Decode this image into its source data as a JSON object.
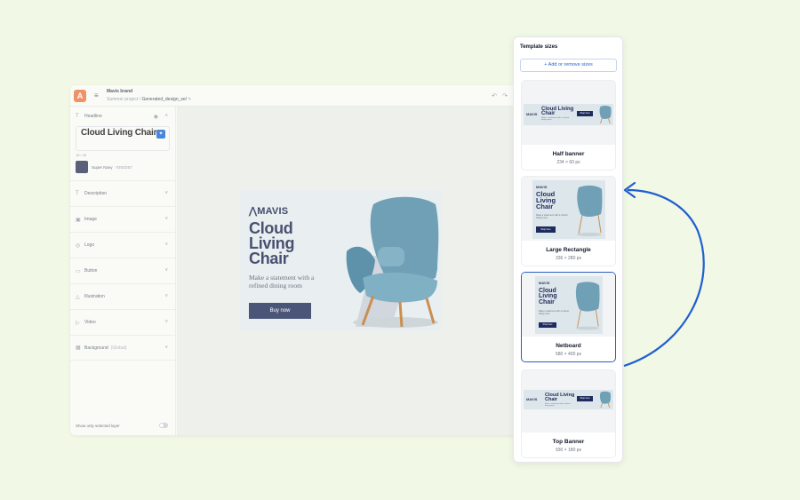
{
  "editor": {
    "brand": "Mavis brand",
    "project": "Summer project",
    "file": "Generated_design_sel",
    "headline_label": "Headline",
    "headline_text": "Cloud Living Chair",
    "char_count": "18 / 40",
    "color_name": "Super Navy",
    "color_hex": "#292D57",
    "sections": [
      {
        "label": "Description"
      },
      {
        "label": "Image"
      },
      {
        "label": "Logo"
      },
      {
        "label": "Button"
      },
      {
        "label": "Illustration"
      },
      {
        "label": "Video"
      },
      {
        "label": "Background",
        "sub": "(Global)"
      }
    ],
    "footer_toggle_label": "Show only selected layer"
  },
  "ad": {
    "logo": "MAVIS",
    "title": "Cloud Living Chair",
    "description": "Make a statement with a refined dining room",
    "cta": "Buy now"
  },
  "panel": {
    "title": "Template sizes",
    "add_button": "Add or remove sizes",
    "templates": [
      {
        "name": "Half banner",
        "dims": "234 × 60 px",
        "selected": false
      },
      {
        "name": "Large Rectangle",
        "dims": "336 × 280 px",
        "selected": false
      },
      {
        "name": "Netboard",
        "dims": "580 × 400 px",
        "selected": true
      },
      {
        "name": "Top Banner",
        "dims": "930 × 180 px",
        "selected": false
      }
    ],
    "mini": {
      "logo": "MAVIS",
      "title": "Cloud Living Chair",
      "desc": "Make a statement with a refined dining room",
      "cta": "Shop here"
    }
  },
  "colors": {
    "accent": "#2b5fbf",
    "navy": "#1f2b5e",
    "background": "#f1f8e6"
  }
}
